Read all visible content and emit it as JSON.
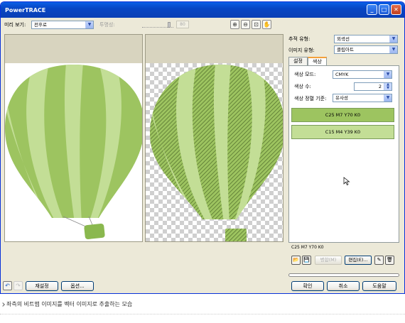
{
  "window": {
    "title": "PowerTRACE",
    "min_icon": "minimize-icon",
    "max_icon": "maximize-icon",
    "close_icon": "close-icon"
  },
  "toolbar": {
    "preview_label": "미리 보기:",
    "preview_value": "전후로",
    "transparency_label": "투명성:",
    "transparency_value": "80",
    "tools": [
      "zoom-in-icon",
      "zoom-out-icon",
      "fit-icon",
      "pan-hand-icon"
    ]
  },
  "settings": {
    "trace_type_label": "추적 유형:",
    "trace_type_value": "외곽선",
    "image_type_label": "이미지 유형:",
    "image_type_value": "클립아트",
    "tabs": [
      "설정",
      "색상"
    ],
    "active_tab": "색상",
    "color_mode_label": "색상 모드:",
    "color_mode_value": "CMYK",
    "color_count_label": "색상 수:",
    "color_count_value": "2",
    "sort_label": "색상 정렬 기준:",
    "sort_value": "유사성"
  },
  "swatches": [
    {
      "label": "C25 M7 Y70 K0",
      "color": "#9dc460"
    },
    {
      "label": "C15 M4 Y39 K0",
      "color": "#c3de96"
    }
  ],
  "selected_color_info": "C25 M7 Y70 K0",
  "color_actions": {
    "open_icon": "open-palette-icon",
    "save_icon": "save-palette-icon",
    "merge_label": "병합(M)",
    "edit_label": "편집(E)...",
    "eyedropper_icon": "eyedropper-icon",
    "delete_icon": "trash-icon"
  },
  "footer": {
    "undo_icon": "undo-icon",
    "redo_icon": "redo-icon",
    "reset_label": "재설정",
    "options_label": "옵션...",
    "ok_label": "확인",
    "cancel_label": "취소",
    "help_label": "도움말"
  },
  "caption": "좌측의 비트맵 이미지를 벡터 이미지로 추출하는 모습",
  "colors": {
    "balloon_dark": "#9dc460",
    "balloon_light": "#c3de96",
    "basket": "#8ab84e",
    "hatch": "#4f6b2a"
  }
}
